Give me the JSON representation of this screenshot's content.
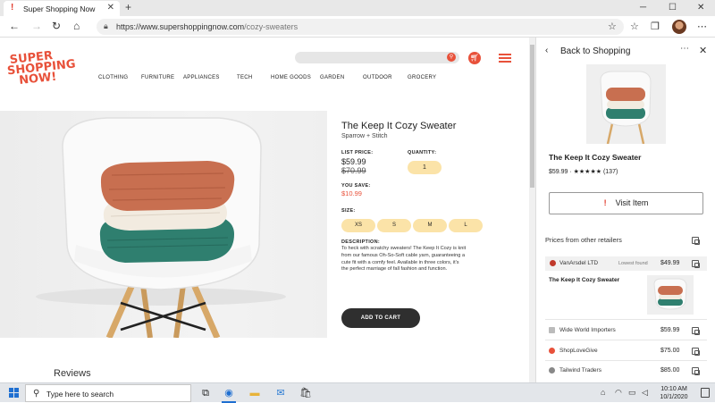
{
  "browser": {
    "tab_title": "Super Shopping Now",
    "tab_favicon": "!",
    "new_tab": "+",
    "url_domain": "https://www.supershoppingnow.com",
    "url_path": "/cozy-sweaters",
    "icons": [
      "back-arrow-icon",
      "forward-arrow-icon",
      "refresh-icon",
      "home-icon",
      "lock-icon",
      "favorite-star-icon",
      "favorites-icon",
      "collections-icon",
      "profile-avatar"
    ]
  },
  "site": {
    "logo_lines": [
      "SUPER",
      "SHOPPING",
      "NOW!"
    ],
    "nav": [
      "CLOTHING",
      "FURNITURE",
      "APPLIANCES",
      "TECH",
      "HOME GOODS",
      "GARDEN",
      "OUTDOOR",
      "GROCERY"
    ],
    "accent_color": "#e8513a"
  },
  "product": {
    "title": "The Keep It Cozy Sweater",
    "brand": "Sparrow + Stitch",
    "list_price_label": "LIST PRICE:",
    "list_price": "$59.99",
    "old_price": "$70.99",
    "quantity_label": "QUANTITY:",
    "quantity": "1",
    "you_save_label": "YOU SAVE:",
    "you_save": "$10.99",
    "size_label": "SIZE:",
    "sizes": [
      "XS",
      "S",
      "M",
      "L"
    ],
    "description_label": "DESCRIPTION:",
    "description": "To heck with scratchy sweaters! The Keep It Cozy is knit from our famous Oh-So-Soft cable yarn, guaranteeing a cute fit with a comfy feel. Available in three colors, it's the perfect marriage of fall fashion and function.",
    "add_to_cart": "ADD TO CART",
    "reviews_heading": "Reviews"
  },
  "panel": {
    "back_label": "Back to Shopping",
    "more": "⋯",
    "close": "✕",
    "title": "The Keep It Cozy Sweater",
    "price_rating": "$59.99 · ★★★★★ (137)",
    "visit_label": "Visit Item",
    "other_retailers_label": "Prices from other retailers",
    "best": {
      "name": "VanArsdel LTD",
      "note": "Lowest found",
      "price": "$49.99"
    },
    "best_product": "The Keep It Cozy Sweater",
    "retailers": [
      {
        "name": "Wide World Importers",
        "price": "$59.99"
      },
      {
        "name": "ShopLoveGive",
        "price": "$75.00"
      },
      {
        "name": "Tailwind Traders",
        "price": "$85.00"
      }
    ]
  },
  "taskbar": {
    "search_placeholder": "Type here to search",
    "time": "10:10 AM",
    "date": "10/1/2020"
  }
}
